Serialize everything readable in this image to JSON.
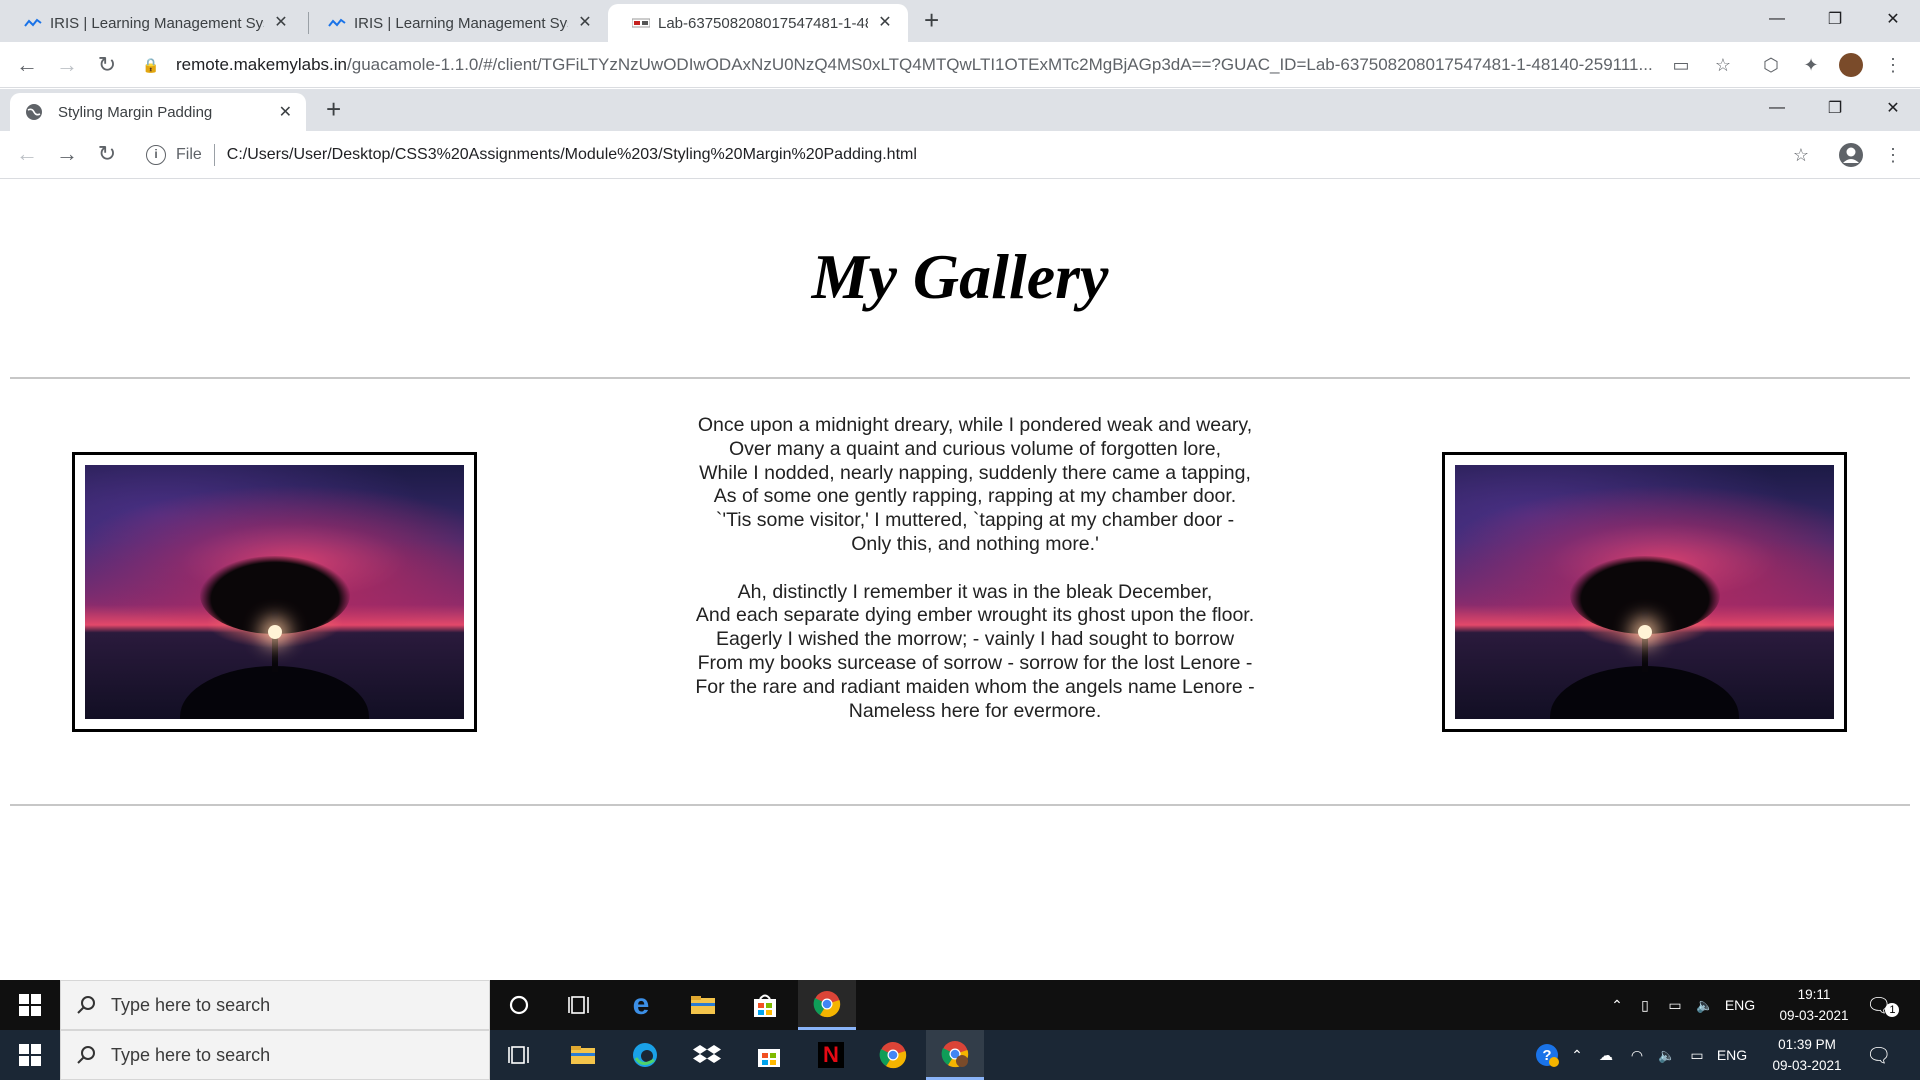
{
  "outer_browser": {
    "tabs": [
      {
        "label": "IRIS | Learning Management Syst",
        "icon": "iris-logo-icon"
      },
      {
        "label": "IRIS | Learning Management Syst",
        "icon": "iris-logo-icon"
      },
      {
        "label": "Lab-637508208017547481-1-48",
        "icon": "guacamole-icon",
        "active": true
      }
    ],
    "url_host": "remote.makemylabs.in",
    "url_path": "/guacamole-1.1.0/#/client/TGFiLTYzNzUwODIwODAxNzU0NzQ4MS0xLTQ4MTQwLTI1OTExMTc2MgBjAGp3dA==?GUAC_ID=Lab-637508208017547481-1-48140-259111..."
  },
  "inner_browser": {
    "tab_label": "Styling Margin Padding",
    "url_file_label": "File",
    "url": "C:/Users/User/Desktop/CSS3%20Assignments/Module%203/Styling%20Margin%20Padding.html"
  },
  "page": {
    "title": "My Gallery",
    "poem": {
      "stanza1": [
        "Once upon a midnight dreary, while I pondered weak and weary,",
        "Over many a quaint and curious volume of forgotten lore,",
        "While I nodded, nearly napping, suddenly there came a tapping,",
        "As of some one gently rapping, rapping at my chamber door.",
        "`'Tis some visitor,' I muttered, `tapping at my chamber door -",
        "Only this, and nothing more.'"
      ],
      "stanza2": [
        "Ah, distinctly I remember it was in the bleak December,",
        "And each separate dying ember wrought its ghost upon the floor.",
        "Eagerly I wished the morrow; - vainly I had sought to borrow",
        "From my books surcease of sorrow - sorrow for the lost Lenore -",
        "For the rare and radiant maiden whom the angels name Lenore -",
        "Nameless here for evermore."
      ]
    }
  },
  "taskbar_remote": {
    "search_placeholder": "Type here to search",
    "language": "ENG",
    "time": "19:11",
    "date": "09-03-2021",
    "notification_count": "1"
  },
  "taskbar_local": {
    "search_placeholder": "Type here to search",
    "language": "ENG",
    "time": "01:39 PM",
    "date": "09-03-2021"
  }
}
